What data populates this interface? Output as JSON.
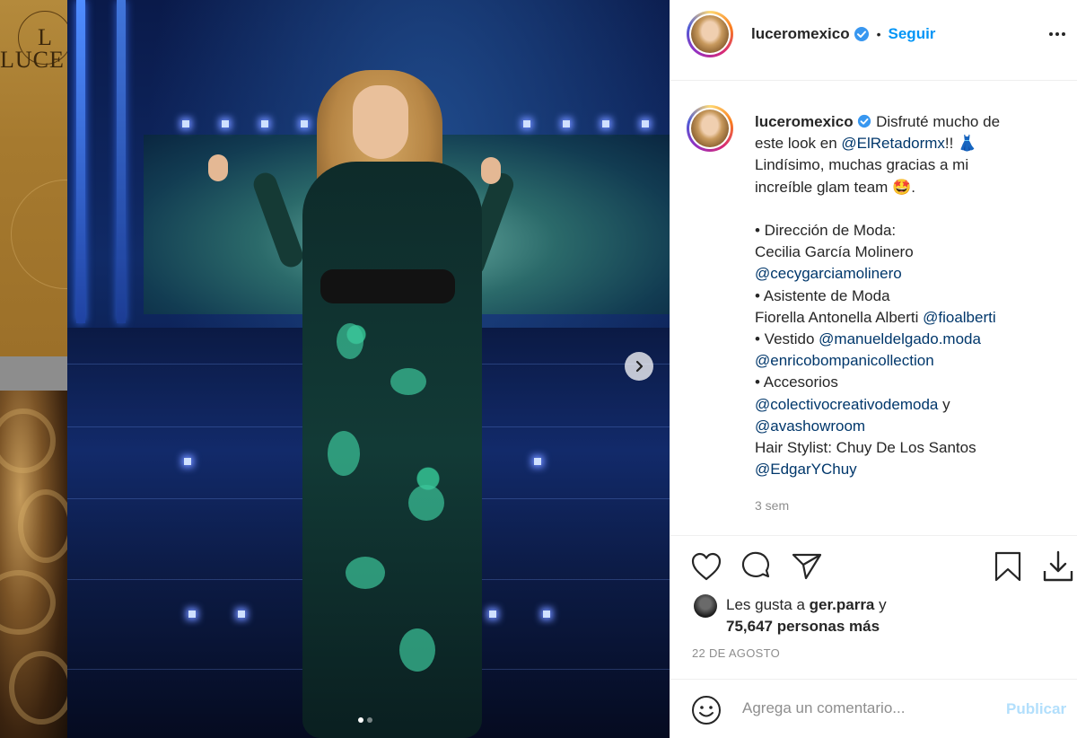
{
  "background_brand": {
    "monogram": "L",
    "text": "LUCE"
  },
  "post": {
    "username": "luceromexico",
    "follow_label": "Seguir",
    "separator": "•",
    "caption": {
      "l1_text": " Disfruté mucho de",
      "l2_prefix": "este look en ",
      "l2_mention": "@ElRetadormx",
      "l2_suffix": "!! 👗",
      "l3": "Lindísimo, muchas gracias a mi",
      "l4": "increíble glam team 🤩.",
      "l5": "• Dirección de Moda:",
      "l6": "Cecilia García Molinero",
      "l7_mention": "@cecygarciamolinero",
      "l8": "• Asistente de Moda",
      "l9_prefix": "Fiorella Antonella Alberti ",
      "l9_mention": "@fioalberti",
      "l10_prefix": "• Vestido ",
      "l10_mention": "@manueldelgado.moda",
      "l11_mention": "@enricobompanicollection",
      "l12": "• Accesorios",
      "l13_mention": "@colectivocreativodemoda",
      "l13_suffix": " y",
      "l14_mention": "@avashowroom",
      "l15": "Hair Stylist: Chuy De Los Santos",
      "l16_mention": "@EdgarYChuy"
    },
    "time_ago": "3 sem",
    "likes": {
      "prefix": "Les gusta a ",
      "user": "ger.parra",
      "mid": " y",
      "count_text": "75,647 personas más"
    },
    "date": "22 DE AGOSTO",
    "comment_placeholder": "Agrega un comentario...",
    "publish_label": "Publicar",
    "carousel": {
      "current": 1,
      "total": 2
    }
  },
  "icons": [
    "verified-icon",
    "more-icon",
    "heart-icon",
    "comment-icon",
    "share-icon",
    "bookmark-icon",
    "download-icon",
    "emoji-icon",
    "chevron-right-icon"
  ],
  "colors": {
    "link": "#00376b",
    "follow": "#0095f6",
    "publish_disabled": "#b2dffc",
    "muted": "#8e8e8e",
    "text": "#262626"
  }
}
